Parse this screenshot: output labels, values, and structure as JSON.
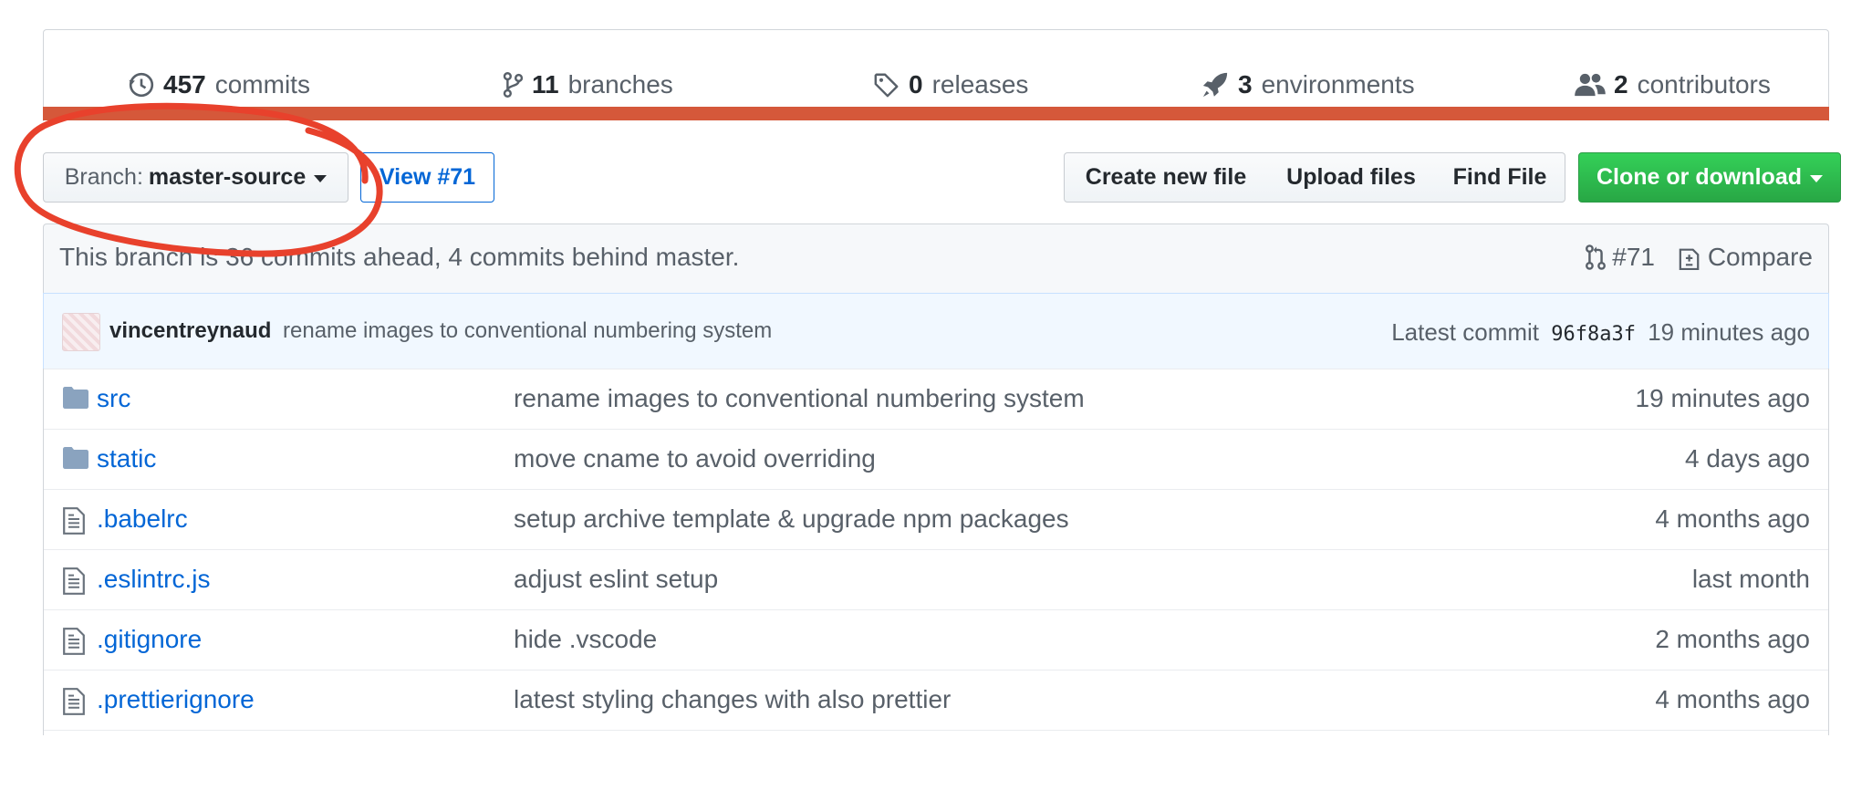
{
  "summary": {
    "commits": {
      "count": "457",
      "label": "commits"
    },
    "branches": {
      "count": "11",
      "label": "branches"
    },
    "releases": {
      "count": "0",
      "label": "releases"
    },
    "environments": {
      "count": "3",
      "label": "environments"
    },
    "contributors": {
      "count": "2",
      "label": "contributors"
    },
    "language_bar_color": "#d5583a"
  },
  "toolbar": {
    "branch_prefix": "Branch:",
    "branch_name": "master-source",
    "view_pr_label": "View #71",
    "create_file_label": "Create new file",
    "upload_files_label": "Upload files",
    "find_file_label": "Find File",
    "clone_label": "Clone or download"
  },
  "annotation": {
    "color": "#e8412c",
    "shape": "hand-drawn circle around branch selector"
  },
  "branch_info": {
    "text": "This branch is 36 commits ahead, 4 commits behind master.",
    "pr_label": "#71",
    "compare_label": "Compare"
  },
  "latest_commit": {
    "author": "vincentreynaud",
    "message": "rename images to conventional numbering system",
    "prefix": "Latest commit",
    "sha": "96f8a3f",
    "age": "19 minutes ago"
  },
  "files": [
    {
      "name": "src",
      "type": "folder",
      "message": "rename images to conventional numbering system",
      "age": "19 minutes ago"
    },
    {
      "name": "static",
      "type": "folder",
      "message": "move cname to avoid overriding",
      "age": "4 days ago"
    },
    {
      "name": ".babelrc",
      "type": "file",
      "message": "setup archive template & upgrade npm packages",
      "age": "4 months ago"
    },
    {
      "name": ".eslintrc.js",
      "type": "file",
      "message": "adjust eslint setup",
      "age": "last month"
    },
    {
      "name": ".gitignore",
      "type": "file",
      "message": "hide .vscode",
      "age": "2 months ago"
    },
    {
      "name": ".prettierignore",
      "type": "file",
      "message": "latest styling changes with also prettier",
      "age": "4 months ago"
    }
  ],
  "colors": {
    "link": "#0366d6",
    "accent_green": "#28a745",
    "muted": "#586069"
  }
}
